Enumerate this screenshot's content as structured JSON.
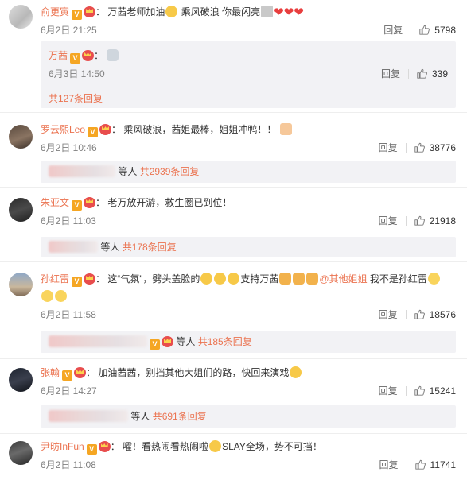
{
  "comments": [
    {
      "user": "俞更寅",
      "colon": "：",
      "text_before": "万茜老师加油",
      "text_after": "乘风破浪 你最闪亮",
      "time": "6月2日 21:25",
      "reply_label": "回复",
      "likes": "5798",
      "reply": {
        "user": "万茜",
        "colon": "：",
        "time": "6月3日 14:50",
        "reply_label": "回复",
        "likes": "339"
      },
      "more_text": "共127条回复"
    },
    {
      "user": "罗云熙Leo",
      "colon": "：",
      "text": "乘风破浪，茜姐最棒，姐姐冲鸭！！",
      "time": "6月2日 10:46",
      "reply_label": "回复",
      "likes": "38776",
      "more_prefix": "等人",
      "more_text": "共2939条回复"
    },
    {
      "user": "朱亚文",
      "colon": "：",
      "text": "老万放开游，救生圈已到位！",
      "time": "6月2日 11:03",
      "reply_label": "回复",
      "likes": "21918",
      "more_prefix": "等人",
      "more_text": "共178条回复"
    },
    {
      "user": "孙红雷",
      "colon": "：",
      "text_before": "这“气氛”，劈头盖脸的",
      "text_middle": "支持万茜",
      "mention": "@其他姐姐",
      "text_after": "我不是孙红雷",
      "time": "6月2日 11:58",
      "reply_label": "回复",
      "likes": "18576",
      "more_prefix": "等人",
      "more_text": "共185条回复"
    },
    {
      "user": "张翰",
      "colon": "：",
      "text": "加油茜茜，别挡其他大姐们的路，快回来演戏",
      "time": "6月2日 14:27",
      "reply_label": "回复",
      "likes": "15241",
      "more_prefix": "等人",
      "more_text": "共691条回复"
    },
    {
      "user": "尹昉InFun",
      "colon": "：",
      "text_before": "嚯！看热闹看热闹啦",
      "text_after": "SLAY全场，势不可挡！",
      "time": "6月2日 11:08",
      "reply_label": "回复",
      "likes": "11741"
    }
  ],
  "icons": {
    "verified": "V",
    "heart": "❤"
  },
  "colors": {
    "username": "#eb7350",
    "meta": "#808080",
    "subbox": "#f2f2f5"
  }
}
